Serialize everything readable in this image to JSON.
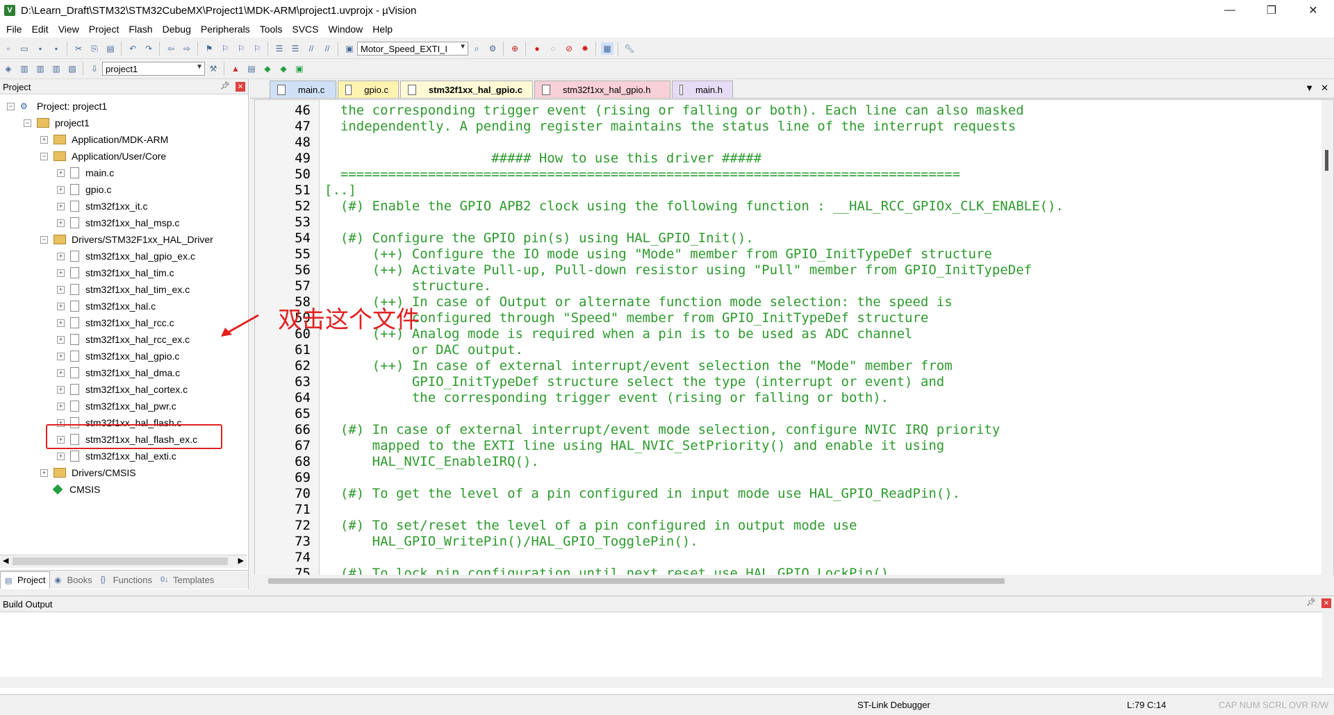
{
  "window": {
    "title": "D:\\Learn_Draft\\STM32\\STM32CubeMX\\Project1\\MDK-ARM\\project1.uvprojx - µVision",
    "app_icon": "V",
    "controls": [
      "—",
      "❐",
      "✕"
    ]
  },
  "menu": [
    "File",
    "Edit",
    "View",
    "Project",
    "Flash",
    "Debug",
    "Peripherals",
    "Tools",
    "SVCS",
    "Window",
    "Help"
  ],
  "toolbar": {
    "target_combo": "Motor_Speed_EXTI_I",
    "project_combo": "project1"
  },
  "project_panel": {
    "title": "Project",
    "tree": [
      {
        "label": "Project: project1",
        "level": 0,
        "kind": "root"
      },
      {
        "label": "project1",
        "level": 1,
        "kind": "target"
      },
      {
        "label": "Application/MDK-ARM",
        "level": 2,
        "kind": "folder"
      },
      {
        "label": "Application/User/Core",
        "level": 2,
        "kind": "folder"
      },
      {
        "label": "main.c",
        "level": 3,
        "kind": "file"
      },
      {
        "label": "gpio.c",
        "level": 3,
        "kind": "file"
      },
      {
        "label": "stm32f1xx_it.c",
        "level": 3,
        "kind": "file"
      },
      {
        "label": "stm32f1xx_hal_msp.c",
        "level": 3,
        "kind": "file"
      },
      {
        "label": "Drivers/STM32F1xx_HAL_Driver",
        "level": 2,
        "kind": "folder"
      },
      {
        "label": "stm32f1xx_hal_gpio_ex.c",
        "level": 3,
        "kind": "file"
      },
      {
        "label": "stm32f1xx_hal_tim.c",
        "level": 3,
        "kind": "file"
      },
      {
        "label": "stm32f1xx_hal_tim_ex.c",
        "level": 3,
        "kind": "file"
      },
      {
        "label": "stm32f1xx_hal.c",
        "level": 3,
        "kind": "file"
      },
      {
        "label": "stm32f1xx_hal_rcc.c",
        "level": 3,
        "kind": "file"
      },
      {
        "label": "stm32f1xx_hal_rcc_ex.c",
        "level": 3,
        "kind": "file"
      },
      {
        "label": "stm32f1xx_hal_gpio.c",
        "level": 3,
        "kind": "file"
      },
      {
        "label": "stm32f1xx_hal_dma.c",
        "level": 3,
        "kind": "file"
      },
      {
        "label": "stm32f1xx_hal_cortex.c",
        "level": 3,
        "kind": "file"
      },
      {
        "label": "stm32f1xx_hal_pwr.c",
        "level": 3,
        "kind": "file"
      },
      {
        "label": "stm32f1xx_hal_flash.c",
        "level": 3,
        "kind": "file"
      },
      {
        "label": "stm32f1xx_hal_flash_ex.c",
        "level": 3,
        "kind": "file"
      },
      {
        "label": "stm32f1xx_hal_exti.c",
        "level": 3,
        "kind": "file"
      },
      {
        "label": "Drivers/CMSIS",
        "level": 2,
        "kind": "folder"
      },
      {
        "label": "CMSIS",
        "level": 2,
        "kind": "cmsis"
      }
    ],
    "bottom_tabs": [
      "Project",
      "Books",
      "Functions",
      "Templates"
    ]
  },
  "editor": {
    "tabs": [
      "main.c",
      "gpio.c",
      "stm32f1xx_hal_gpio.c",
      "stm32f1xx_hal_gpio.h",
      "main.h"
    ],
    "active_tab": "stm32f1xx_hal_gpio.c",
    "lines": [
      {
        "n": "46",
        "text": "  the corresponding trigger event (rising or falling or both). Each line can also masked"
      },
      {
        "n": "47",
        "text": "  independently. A pending register maintains the status line of the interrupt requests"
      },
      {
        "n": "48",
        "text": ""
      },
      {
        "n": "49",
        "text": "                     ##### How to use this driver #####"
      },
      {
        "n": "50",
        "text": "  =============================================================================="
      },
      {
        "n": "51",
        "text": "[..]"
      },
      {
        "n": "52",
        "text": "  (#) Enable the GPIO APB2 clock using the following function : __HAL_RCC_GPIOx_CLK_ENABLE()."
      },
      {
        "n": "53",
        "text": ""
      },
      {
        "n": "54",
        "text": "  (#) Configure the GPIO pin(s) using HAL_GPIO_Init()."
      },
      {
        "n": "55",
        "text": "      (++) Configure the IO mode using \"Mode\" member from GPIO_InitTypeDef structure"
      },
      {
        "n": "56",
        "text": "      (++) Activate Pull-up, Pull-down resistor using \"Pull\" member from GPIO_InitTypeDef"
      },
      {
        "n": "57",
        "text": "           structure."
      },
      {
        "n": "58",
        "text": "      (++) In case of Output or alternate function mode selection: the speed is"
      },
      {
        "n": "59",
        "text": "           configured through \"Speed\" member from GPIO_InitTypeDef structure"
      },
      {
        "n": "60",
        "text": "      (++) Analog mode is required when a pin is to be used as ADC channel"
      },
      {
        "n": "61",
        "text": "           or DAC output."
      },
      {
        "n": "62",
        "text": "      (++) In case of external interrupt/event selection the \"Mode\" member from"
      },
      {
        "n": "63",
        "text": "           GPIO_InitTypeDef structure select the type (interrupt or event) and"
      },
      {
        "n": "64",
        "text": "           the corresponding trigger event (rising or falling or both)."
      },
      {
        "n": "65",
        "text": ""
      },
      {
        "n": "66",
        "text": "  (#) In case of external interrupt/event mode selection, configure NVIC IRQ priority"
      },
      {
        "n": "67",
        "text": "      mapped to the EXTI line using HAL_NVIC_SetPriority() and enable it using"
      },
      {
        "n": "68",
        "text": "      HAL_NVIC_EnableIRQ()."
      },
      {
        "n": "69",
        "text": ""
      },
      {
        "n": "70",
        "text": "  (#) To get the level of a pin configured in input mode use HAL_GPIO_ReadPin()."
      },
      {
        "n": "71",
        "text": ""
      },
      {
        "n": "72",
        "text": "  (#) To set/reset the level of a pin configured in output mode use"
      },
      {
        "n": "73",
        "text": "      HAL_GPIO_WritePin()/HAL_GPIO_TogglePin()."
      },
      {
        "n": "74",
        "text": ""
      },
      {
        "n": "75",
        "text": "  (#) To lock pin configuration until next reset use HAL_GPIO_LockPin()."
      }
    ]
  },
  "annotation": {
    "text": "双击这个文件",
    "color": "#e02020"
  },
  "build_output": {
    "title": "Build Output"
  },
  "status": {
    "debugger": "ST-Link Debugger",
    "position": "L:79 C:14",
    "caps": "CAP NUM SCRL OVR R/W"
  },
  "colors": {
    "comment_green": "#2c9a2c",
    "highlight_red": "#e02020"
  }
}
